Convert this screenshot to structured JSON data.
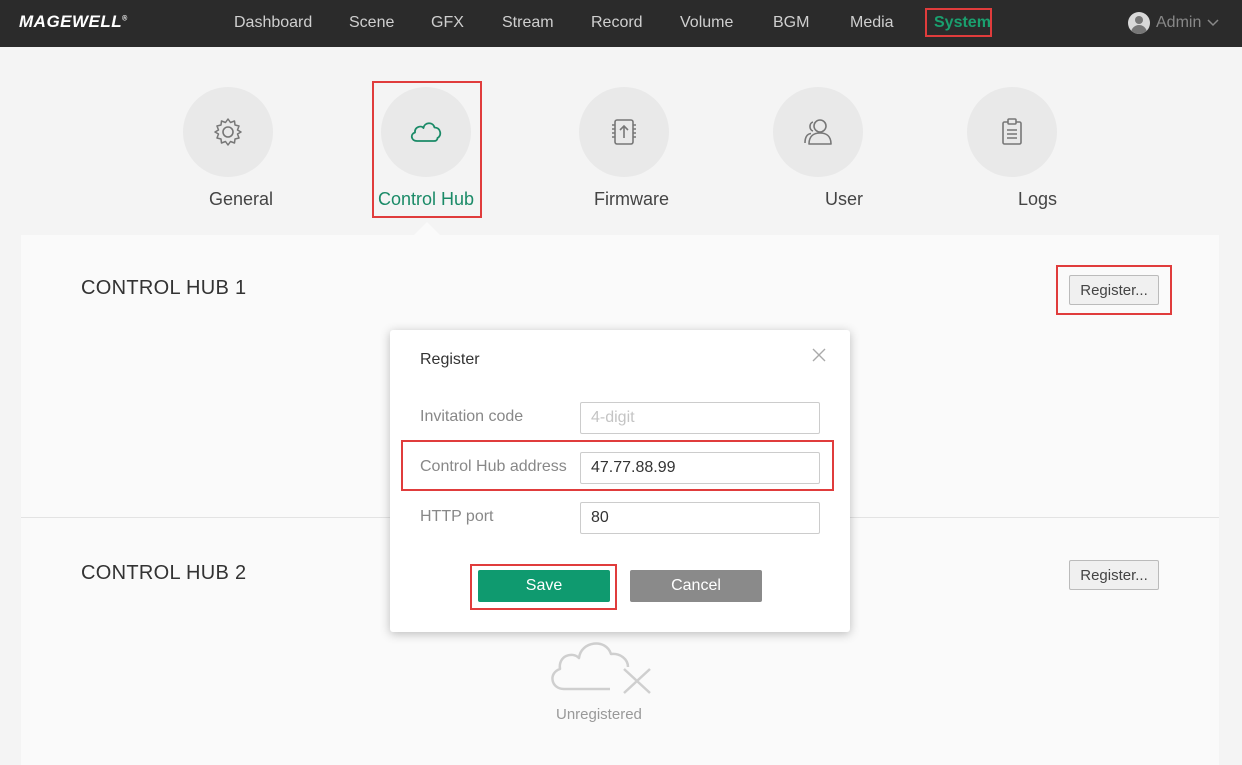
{
  "brand": {
    "name": "MAGEWELL",
    "mark": "®"
  },
  "nav": {
    "items": [
      "Dashboard",
      "Scene",
      "GFX",
      "Stream",
      "Record",
      "Volume",
      "BGM",
      "Media",
      "System"
    ],
    "active": "System",
    "user": "Admin"
  },
  "tabs": {
    "items": [
      {
        "label": "General",
        "icon": "gear-icon"
      },
      {
        "label": "Control Hub",
        "icon": "cloud-icon"
      },
      {
        "label": "Firmware",
        "icon": "firmware-chip-icon"
      },
      {
        "label": "User",
        "icon": "users-icon"
      },
      {
        "label": "Logs",
        "icon": "clipboard-icon"
      }
    ],
    "active": "Control Hub"
  },
  "hubs": [
    {
      "title": "CONTROL HUB 1",
      "register_label": "Register..."
    },
    {
      "title": "CONTROL HUB 2",
      "register_label": "Register...",
      "status": "Unregistered"
    }
  ],
  "modal": {
    "title": "Register",
    "fields": {
      "invitation": {
        "label": "Invitation code",
        "placeholder": "4-digit",
        "value": ""
      },
      "address": {
        "label": "Control Hub address",
        "value": "47.77.88.99"
      },
      "port": {
        "label": "HTTP port",
        "value": "80"
      }
    },
    "save_label": "Save",
    "cancel_label": "Cancel"
  },
  "colors": {
    "accent": "#0f9a6f",
    "highlight": "#e03c3c",
    "topbar": "#2b2b2b"
  }
}
